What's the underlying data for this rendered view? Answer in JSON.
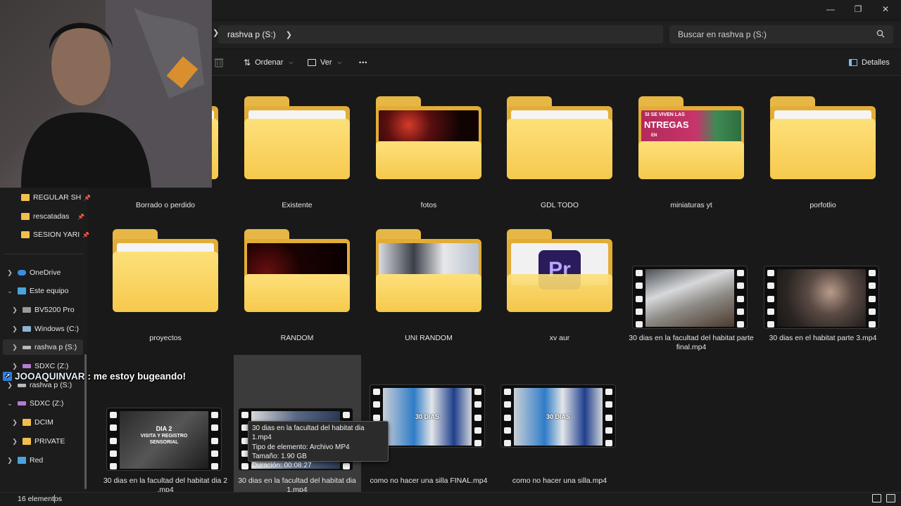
{
  "address": {
    "location": "rashva p (S:)"
  },
  "search": {
    "placeholder": "Buscar en rashva p (S:)"
  },
  "toolbar": {
    "sort_label": "Ordenar",
    "view_label": "Ver",
    "more_label": "•••",
    "details_label": "Detalles"
  },
  "sidebar": {
    "quick": [
      {
        "label": "REGULAR SH"
      },
      {
        "label": "rescatadas"
      },
      {
        "label": "SESION YARI"
      }
    ],
    "tree": [
      {
        "label": "OneDrive"
      },
      {
        "label": "Este equipo"
      },
      {
        "label": "BV5200 Pro"
      },
      {
        "label": "Windows (C:)"
      },
      {
        "label": "rashva p (S:)"
      },
      {
        "label": "SDXC (Z:)"
      },
      {
        "label": "rashva p (S:)"
      },
      {
        "label": "SDXC (Z:)"
      },
      {
        "label": "DCIM"
      },
      {
        "label": "PRIVATE"
      },
      {
        "label": "Red"
      }
    ]
  },
  "items": [
    {
      "name": "Borrado o perdido",
      "kind": "folder"
    },
    {
      "name": "Existente",
      "kind": "folder"
    },
    {
      "name": "fotos",
      "kind": "folder"
    },
    {
      "name": "GDL TODO",
      "kind": "folder"
    },
    {
      "name": "miniaturas yt",
      "kind": "folder"
    },
    {
      "name": "porfotlio",
      "kind": "folder"
    },
    {
      "name": "proyectos",
      "kind": "folder"
    },
    {
      "name": "RANDOM",
      "kind": "folder"
    },
    {
      "name": "UNI RANDOM",
      "kind": "folder"
    },
    {
      "name": "xv aur",
      "kind": "folder"
    },
    {
      "name": "30 dias en  la facultad del habitat parte final.mp4",
      "kind": "video"
    },
    {
      "name": "30 dias en el habitat parte 3.mp4",
      "kind": "video"
    },
    {
      "name": "30 dias en la facultad del habitat  dia 2 .mp4",
      "kind": "video"
    },
    {
      "name": "30 dias en la facultad del habitat dia 1.mp4",
      "kind": "video"
    },
    {
      "name": "como no hacer una silla FINAL.mp4",
      "kind": "video"
    },
    {
      "name": "como no hacer una silla.mp4",
      "kind": "video"
    }
  ],
  "thumb_text": {
    "entregas_top": "SI SE   VIVEN LAS",
    "entregas_main": "NTREGAS",
    "entregas_sub": "EN",
    "pr": "Pr",
    "dia2_a": "DIA 2",
    "dia2_b": "VISITA Y REGISTRO",
    "dia2_c": "SENSORIAL",
    "dias1": "30 DIAS",
    "dias2": "30 DIAS"
  },
  "tooltip": {
    "name": "30 dias en la facultad del habitat dia 1.mp4",
    "type": "Tipo de elemento: Archivo MP4",
    "size": "Tamaño: 1.90 GB",
    "duration": "Duración: 00:08:27"
  },
  "status": {
    "count": "16 elementos"
  },
  "chat": {
    "user": "JOOAQUINVAR",
    "message": " : me estoy bugeando!"
  },
  "colors": {
    "folder": "#f6c94d",
    "accent": "#2f7fe0",
    "background": "#191919"
  }
}
